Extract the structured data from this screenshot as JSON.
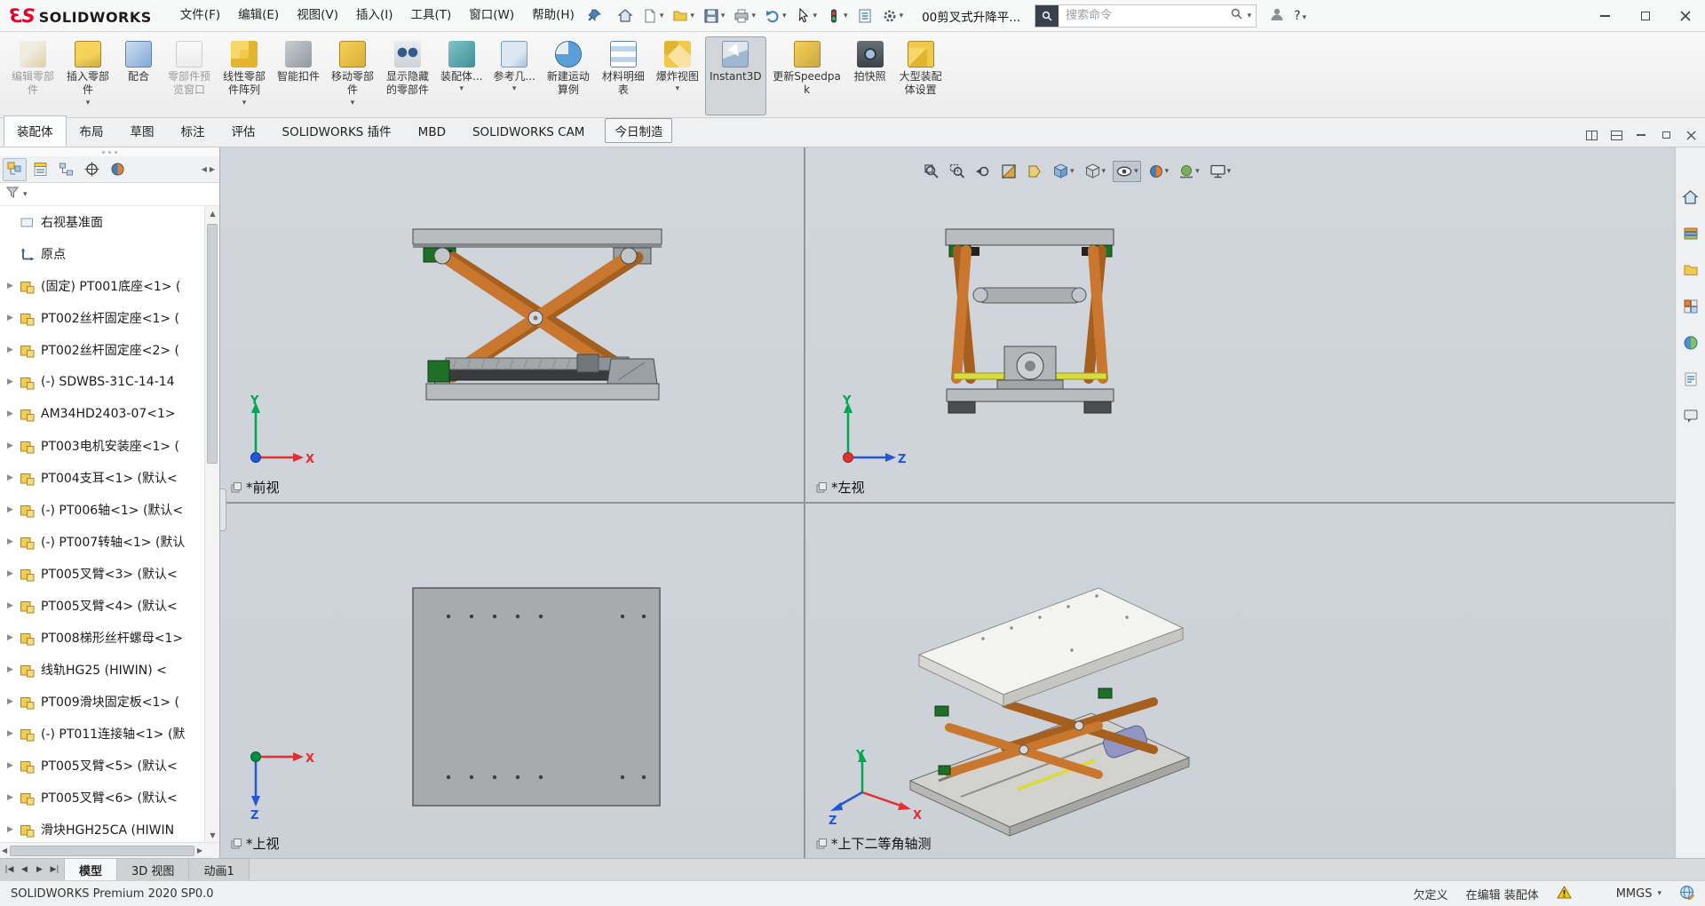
{
  "colors": {
    "brand_red": "#e4002b",
    "arm_orange": "#c9772e",
    "platform_gray": "#b9bcbe",
    "block_green": "#1e7026",
    "screw_yellow": "#d9db40",
    "axis_x_red": "#e03131",
    "axis_y_green": "#00a651",
    "axis_z_blue": "#2457d6",
    "viewport_background": "#ccd2d8"
  },
  "window": {
    "logo": {
      "brand_mark_3": "3",
      "brand_mark_s": "S",
      "brand_text": "SOLIDWORKS"
    },
    "menus": [
      {
        "label": "文件(F)"
      },
      {
        "label": "编辑(E)"
      },
      {
        "label": "视图(V)"
      },
      {
        "label": "插入(I)"
      },
      {
        "label": "工具(T)"
      },
      {
        "label": "窗口(W)"
      },
      {
        "label": "帮助(H)"
      }
    ],
    "pin_icon": "pin-icon",
    "quick_tools": [
      "home-icon",
      "new-document-icon",
      "open-icon",
      "save-icon",
      "print-icon",
      "undo-icon",
      "select-cursor-icon",
      "rebuild-traffic-icon",
      "task-list-icon",
      "options-gear-icon"
    ],
    "document_title": "00剪叉式升降平...",
    "search": {
      "placeholder": "搜索命令",
      "icons": [
        "search-scope-icon",
        "search-icon"
      ]
    },
    "account_icons": [
      "user-icon",
      "help-icon"
    ],
    "help_label": "?",
    "window_controls": [
      "minimize-icon",
      "restore-icon",
      "close-icon"
    ]
  },
  "ribbon": {
    "buttons": [
      {
        "label": "编辑零部件",
        "icon": "edit-component-icon",
        "disabled": true
      },
      {
        "label": "插入零部件",
        "icon": "insert-component-icon",
        "dropdown": true
      },
      {
        "label": "配合",
        "icon": "mate-icon"
      },
      {
        "label": "零部件预览窗口",
        "icon": "component-preview-icon",
        "disabled": true
      },
      {
        "label": "线性零部件阵列",
        "icon": "linear-pattern-icon",
        "dropdown": true
      },
      {
        "label": "智能扣件",
        "icon": "smart-fasteners-icon"
      },
      {
        "label": "移动零部件",
        "icon": "move-component-icon",
        "dropdown": true
      },
      {
        "label": "显示隐藏的零部件",
        "icon": "show-hidden-icon"
      },
      {
        "label": "装配体...",
        "icon": "assembly-features-icon",
        "dropdown": true
      },
      {
        "label": "参考几...",
        "icon": "reference-geometry-icon",
        "dropdown": true
      },
      {
        "label": "新建运动算例",
        "icon": "motion-study-icon"
      },
      {
        "label": "材料明细表",
        "icon": "bom-icon"
      },
      {
        "label": "爆炸视图",
        "icon": "exploded-view-icon",
        "dropdown": true
      },
      {
        "label": "Instant3D",
        "icon": "instant3d-icon",
        "active": true,
        "wide": true
      },
      {
        "label": "更新Speedpak",
        "icon": "speedpak-icon",
        "wide": true
      },
      {
        "label": "拍快照",
        "icon": "snapshot-icon"
      },
      {
        "label": "大型装配体设置",
        "icon": "large-assembly-icon"
      }
    ]
  },
  "command_tabs": {
    "tabs": [
      {
        "label": "装配体",
        "active": true
      },
      {
        "label": "布局"
      },
      {
        "label": "草图"
      },
      {
        "label": "标注"
      },
      {
        "label": "评估"
      },
      {
        "label": "SOLIDWORKS 插件"
      },
      {
        "label": "MBD"
      },
      {
        "label": "SOLIDWORKS CAM"
      },
      {
        "label": "今日制造",
        "boxed": true
      }
    ],
    "window_buttons": [
      "tile-view-icon",
      "split-view-icon",
      "minimize-view-icon",
      "restore-view-icon",
      "close-view-icon"
    ]
  },
  "feature_panel": {
    "manager_tabs": [
      "featuremanager-tree-icon",
      "propertymanager-icon",
      "configurationmanager-icon",
      "dimxpert-icon",
      "displaymanager-icon"
    ],
    "filter_icon": "filter-icon",
    "tree": [
      {
        "label": "右视基准面",
        "icon": "plane-icon"
      },
      {
        "label": "原点",
        "icon": "origin-icon"
      },
      {
        "label": "(固定) PT001底座<1> (",
        "icon": "part-icon",
        "expandable": true
      },
      {
        "label": "PT002丝杆固定座<1> (",
        "icon": "part-icon",
        "expandable": true
      },
      {
        "label": "PT002丝杆固定座<2> (",
        "icon": "part-icon",
        "expandable": true
      },
      {
        "label": "(-) SDWBS-31C-14-14",
        "icon": "part-icon",
        "expandable": true
      },
      {
        "label": "AM34HD2403-07<1>",
        "icon": "part-icon",
        "expandable": true
      },
      {
        "label": "PT003电机安装座<1> (",
        "icon": "part-icon",
        "expandable": true
      },
      {
        "label": "PT004支耳<1> (默认<",
        "icon": "part-icon",
        "expandable": true
      },
      {
        "label": "(-) PT006轴<1> (默认<",
        "icon": "part-icon",
        "expandable": true
      },
      {
        "label": "(-) PT007转轴<1> (默认",
        "icon": "part-icon",
        "expandable": true
      },
      {
        "label": "PT005叉臂<3> (默认<",
        "icon": "part-icon",
        "expandable": true
      },
      {
        "label": "PT005叉臂<4> (默认<",
        "icon": "part-icon",
        "expandable": true
      },
      {
        "label": "PT008梯形丝杆螺母<1>",
        "icon": "part-icon",
        "expandable": true
      },
      {
        "label": "线轨HG25 (HIWIN) <",
        "icon": "part-icon",
        "expandable": true
      },
      {
        "label": "PT009滑块固定板<1> (",
        "icon": "part-icon",
        "expandable": true
      },
      {
        "label": "(-) PT011连接轴<1> (默",
        "icon": "part-icon",
        "expandable": true
      },
      {
        "label": "PT005叉臂<5> (默认<",
        "icon": "part-icon",
        "expandable": true
      },
      {
        "label": "PT005叉臂<6> (默认<",
        "icon": "part-icon",
        "expandable": true
      },
      {
        "label": "滑块HGH25CA (HIWIN",
        "icon": "part-icon",
        "expandable": true
      }
    ]
  },
  "heads_up": {
    "icons": [
      "zoom-fit-icon",
      "zoom-to-area-icon",
      "previous-view-icon",
      "section-view-icon",
      "dynamic-annotation-icon",
      "view-orientation-icon",
      "display-style-icon",
      "hide-show-items-icon",
      "edit-appearance-icon",
      "apply-scene-icon",
      "view-settings-icon"
    ],
    "active_item": "hide-show-items-icon"
  },
  "task_pane": [
    "home-icon",
    "design-library-icon",
    "file-explorer-icon",
    "view-palette-icon",
    "appearances-icon",
    "custom-properties-icon",
    "forum-icon"
  ],
  "viewports": {
    "front": {
      "label": "*前视"
    },
    "left": {
      "label": "*左视"
    },
    "top": {
      "label": "*上视"
    },
    "isometric": {
      "label": "*上下二等角轴测"
    },
    "axis": {
      "x": "X",
      "y": "Y",
      "z": "Z"
    }
  },
  "model_tabs": {
    "tabs": [
      {
        "label": "模型",
        "active": true
      },
      {
        "label": "3D 视图"
      },
      {
        "label": "动画1"
      }
    ]
  },
  "status_bar": {
    "product": "SOLIDWORKS Premium 2020 SP0.0",
    "state": "欠定义",
    "editing": "在编辑 装配体",
    "units": "MMGS"
  }
}
